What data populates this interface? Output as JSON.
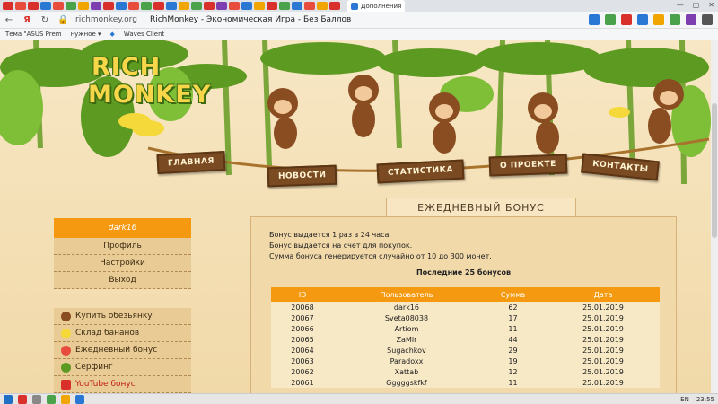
{
  "browser": {
    "tab_title": "Дополнения",
    "url_host": "richmonkey.org",
    "page_title": "RichMonkey - Экономическая Игра - Без Баллов",
    "bookmarks": [
      "Тема \"ASUS Prem",
      "нужное",
      "Waves Client"
    ],
    "colors": {
      "accent": "#f59a10",
      "nav": "#7a4a22"
    }
  },
  "site": {
    "logo_line1": "RICH",
    "logo_line2": "MONKEY",
    "nav": [
      "ГЛАВНАЯ",
      "НОВОСТИ",
      "СТАТИСТИКА",
      "О ПРОЕКТЕ",
      "КОНТАКТЫ"
    ]
  },
  "sidebar": {
    "username": "dark16",
    "user_items": [
      "Профиль",
      "Настройки",
      "Выход"
    ],
    "menu": [
      {
        "label": "Купить обезьянку",
        "icon": "monkey-icon"
      },
      {
        "label": "Склад бананов",
        "icon": "banana-icon"
      },
      {
        "label": "Ежедневный бонус",
        "icon": "bonus-icon"
      },
      {
        "label": "Серфинг",
        "icon": "surfing-icon"
      },
      {
        "label": "YouTube бонус",
        "icon": "youtube-icon"
      }
    ]
  },
  "main": {
    "title": "ЕЖЕДНЕВНЫЙ БОНУС",
    "info_lines": [
      "Бонус выдается 1 раз в 24 часа.",
      "Бонус выдается на счет для покупок.",
      "Сумма бонуса генерируется случайно от 10 до 300 монет."
    ],
    "last_title": "Последние 25 бонусов",
    "columns": [
      "ID",
      "Пользователь",
      "Сумма",
      "Дата"
    ],
    "rows": [
      [
        "20068",
        "dark16",
        "62",
        "25.01.2019"
      ],
      [
        "20067",
        "Sveta08038",
        "17",
        "25.01.2019"
      ],
      [
        "20066",
        "Artiom",
        "11",
        "25.01.2019"
      ],
      [
        "20065",
        "ZaMir",
        "44",
        "25.01.2019"
      ],
      [
        "20064",
        "Sugachkov",
        "29",
        "25.01.2019"
      ],
      [
        "20063",
        "Paradoxx",
        "19",
        "25.01.2019"
      ],
      [
        "20062",
        "Xattab",
        "12",
        "25.01.2019"
      ],
      [
        "20061",
        "Gggggskfkf",
        "11",
        "25.01.2019"
      ]
    ]
  },
  "taskbar": {
    "lang": "EN",
    "time": "23:55"
  }
}
